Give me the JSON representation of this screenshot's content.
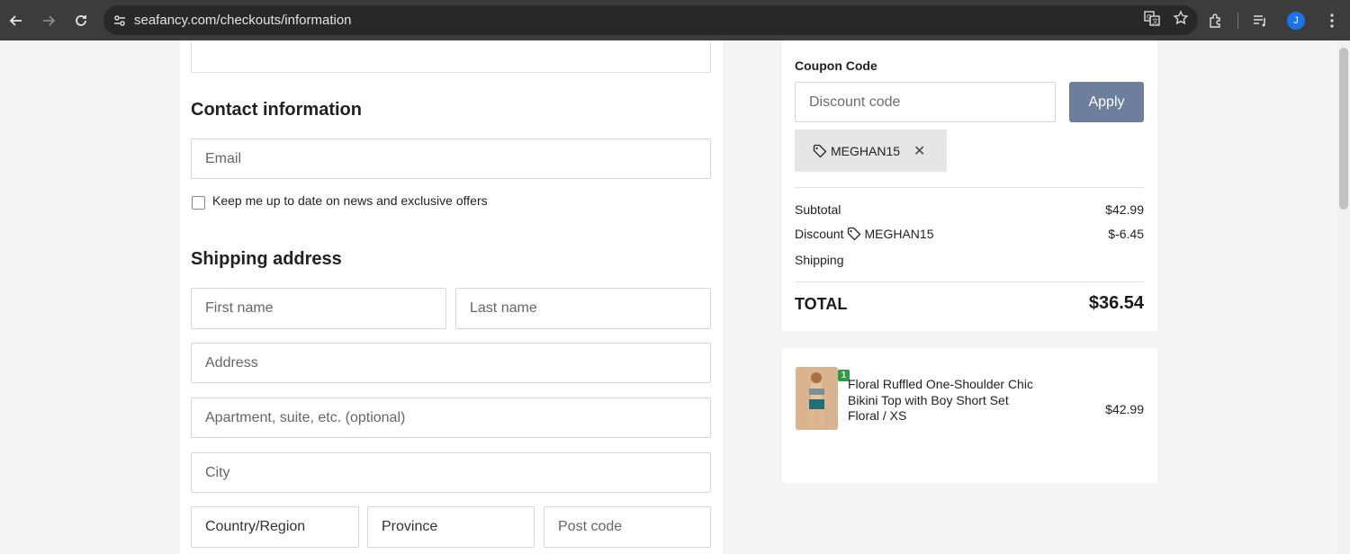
{
  "browser": {
    "url": "seafancy.com/checkouts/information",
    "profile_initial": "J"
  },
  "contact": {
    "heading": "Contact information",
    "email_placeholder": "Email",
    "newsletter_label": "Keep me up to date on news and exclusive offers"
  },
  "shipping": {
    "heading": "Shipping address",
    "first_name_placeholder": "First name",
    "last_name_placeholder": "Last name",
    "address_placeholder": "Address",
    "apartment_placeholder": "Apartment, suite, etc. (optional)",
    "city_placeholder": "City",
    "country_placeholder": "Country/Region",
    "province_placeholder": "Province",
    "postcode_placeholder": "Post code"
  },
  "summary": {
    "coupon_label": "Coupon Code",
    "discount_placeholder": "Discount code",
    "apply_label": "Apply",
    "applied_code": "MEGHAN15",
    "subtotal_label": "Subtotal",
    "subtotal_value": "$42.99",
    "discount_label": "Discount",
    "discount_code": "MEGHAN15",
    "discount_value": "$-6.45",
    "shipping_label": "Shipping",
    "total_label": "TOTAL",
    "total_value": "$36.54"
  },
  "product": {
    "quantity": "1",
    "title": "Floral Ruffled One-Shoulder Chic Bikini Top with Boy Short Set",
    "variant": "Floral / XS",
    "price": "$42.99"
  }
}
